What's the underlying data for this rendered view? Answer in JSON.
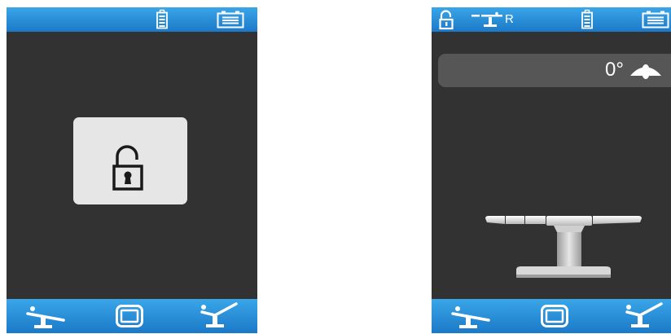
{
  "left_screen": {
    "status_icons": [
      "battery-icon",
      "plug-battery-icon"
    ],
    "center_icon": "unlocked-padlock-icon",
    "bottom_buttons": [
      "table-flat-icon",
      "screen-mode-icon",
      "table-flex-icon"
    ]
  },
  "right_screen": {
    "status_icons": [
      "unlocked-padlock-icon",
      "table-side-icon",
      "battery-icon",
      "plug-battery-icon"
    ],
    "table_side_label": "R",
    "tilt_angle": "0°",
    "tilt_icon": "lateral-tilt-icon",
    "bottom_buttons": [
      "table-flat-icon",
      "screen-mode-icon",
      "table-flex-icon"
    ]
  },
  "colors": {
    "bar_blue": "#2a8ed8",
    "screen_bg": "#323232",
    "panel_light": "#e6e6e6",
    "angle_bar": "#565656"
  }
}
